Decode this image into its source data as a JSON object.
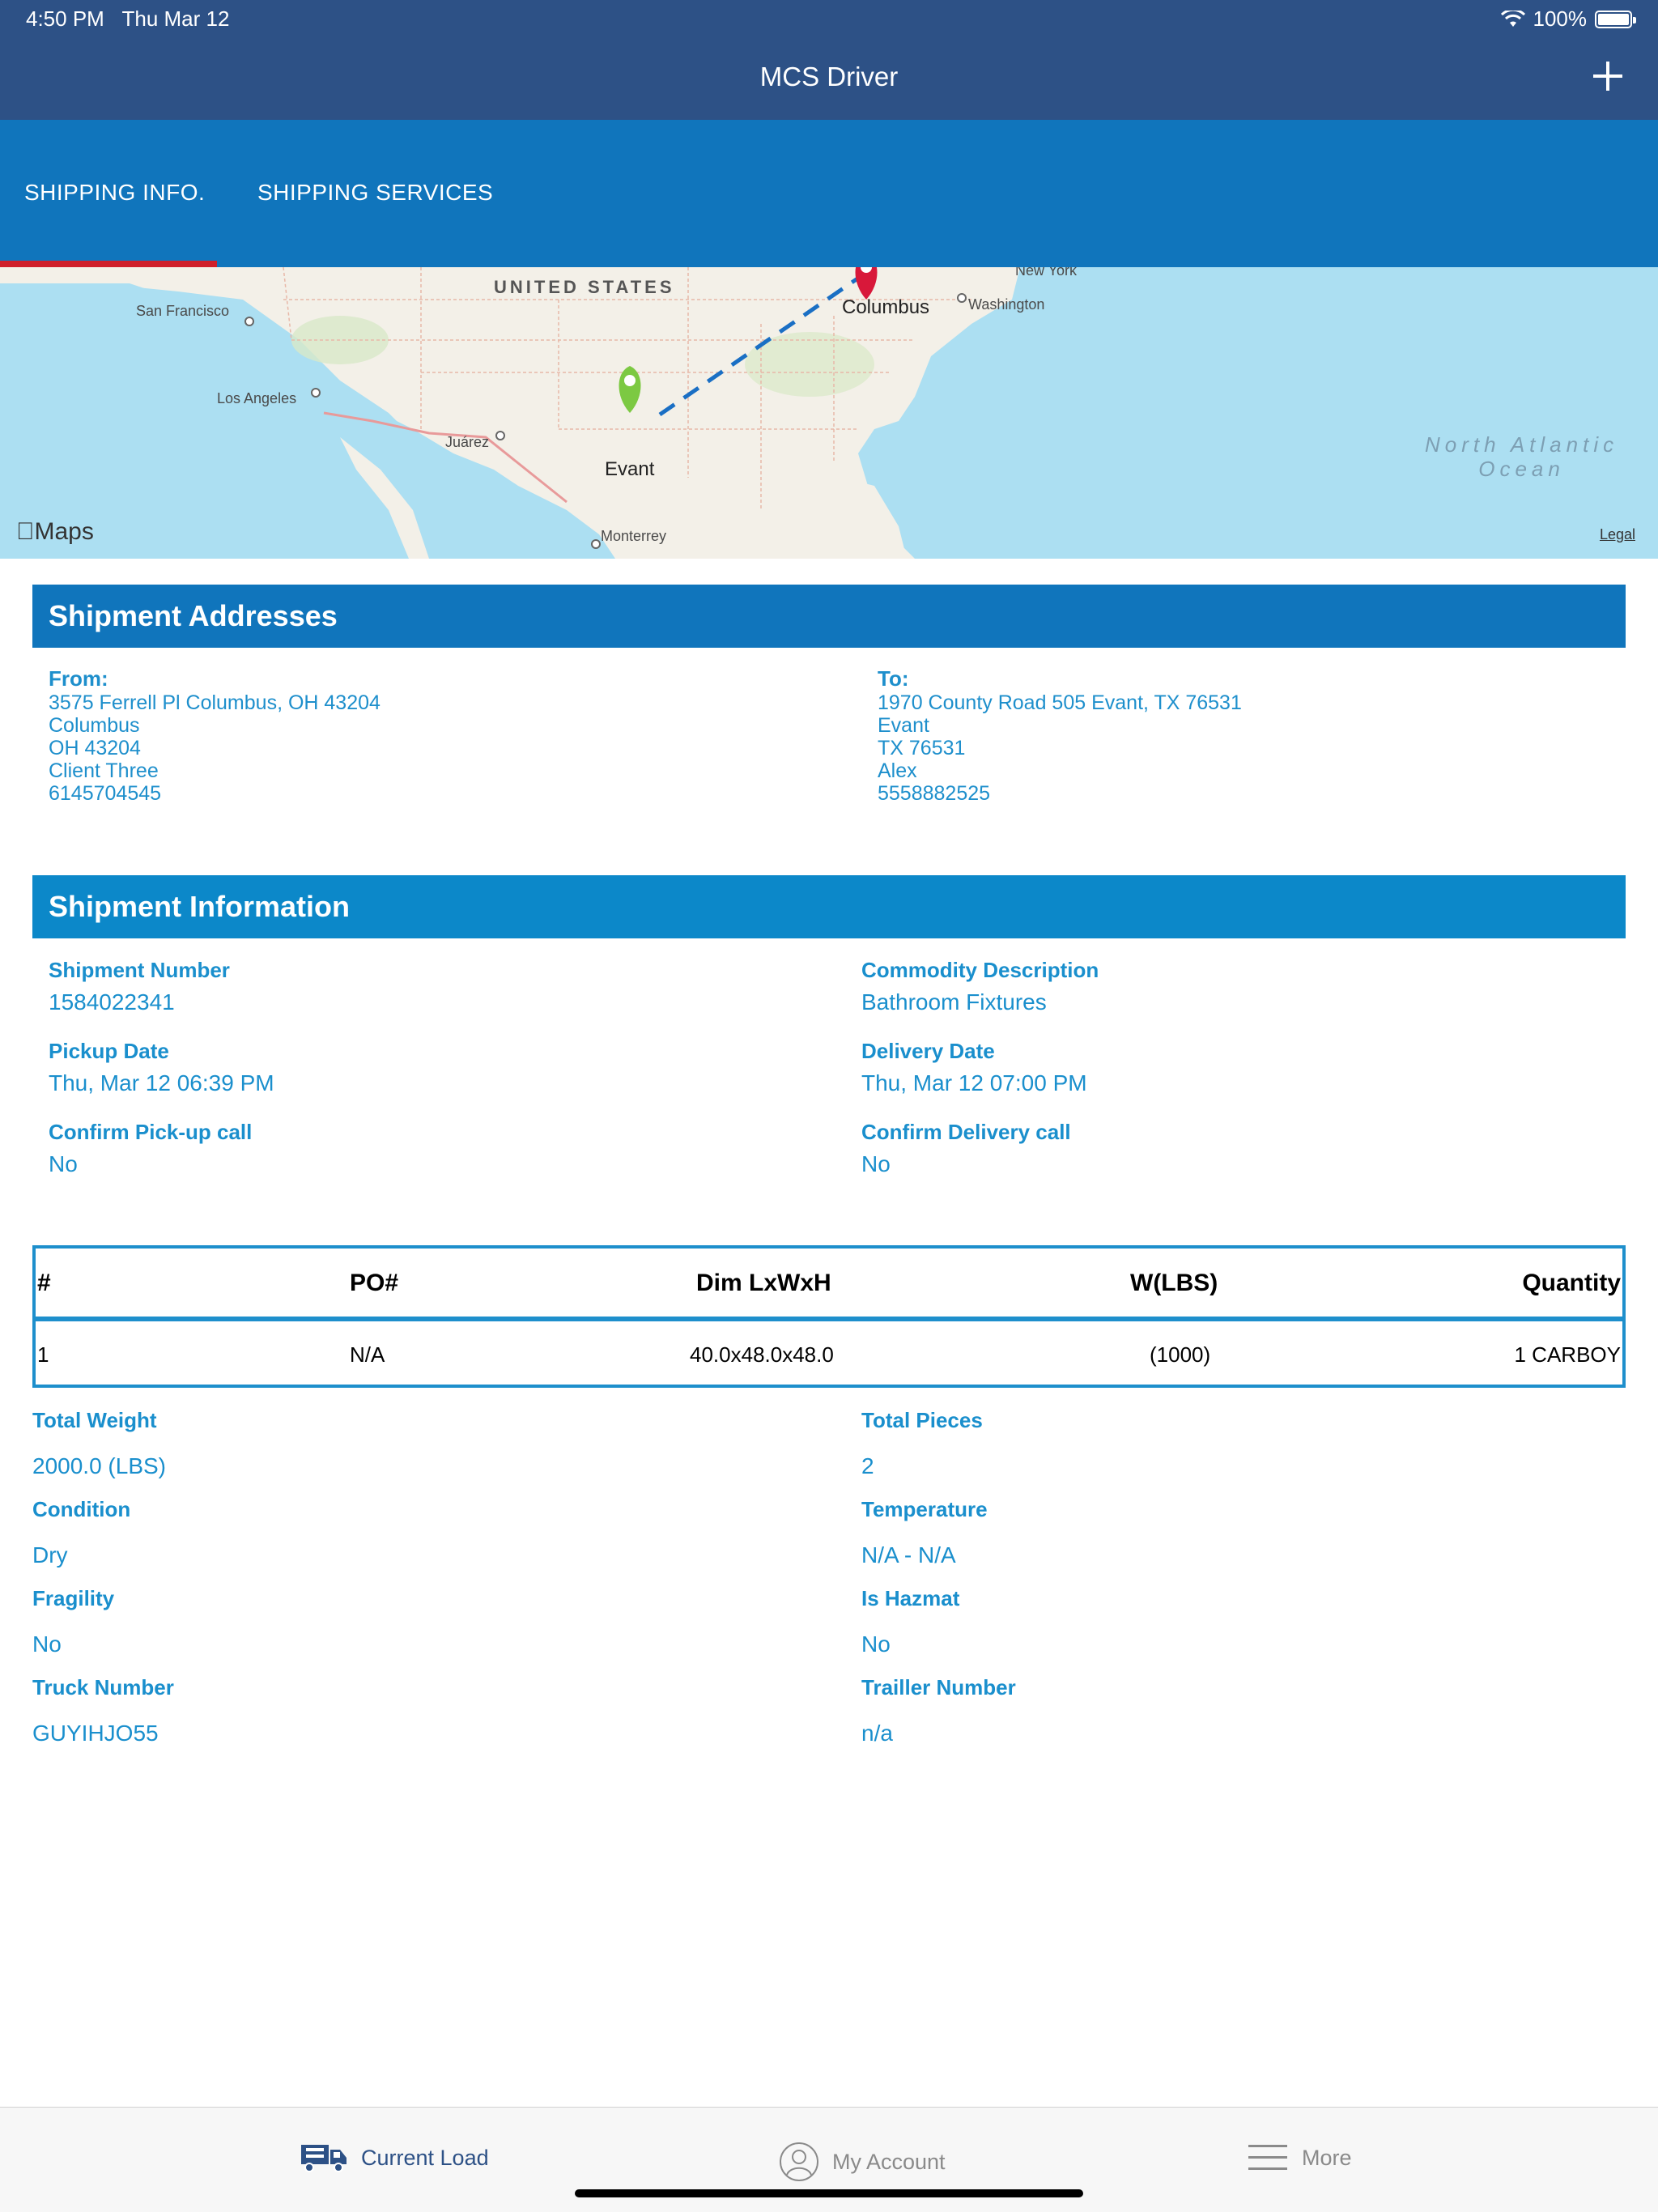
{
  "status_bar": {
    "time": "4:50 PM",
    "date": "Thu Mar 12",
    "battery": "100%"
  },
  "nav": {
    "title": "MCS Driver",
    "add_icon": "plus-icon"
  },
  "tabs": [
    {
      "label": "SHIPPING INFO.",
      "selected": true
    },
    {
      "label": "SHIPPING SERVICES",
      "selected": false
    }
  ],
  "map": {
    "country_label": "UNITED STATES",
    "ocean_label_1": "North Atlantic",
    "ocean_label_2": "Ocean",
    "cities": [
      "San Francisco",
      "Los Angeles",
      "Juárez",
      "Monterrey",
      "New York",
      "Washington"
    ],
    "origin_pin": "Columbus",
    "destination_pin": "Evant",
    "provider": "Maps",
    "legal": "Legal"
  },
  "addresses": {
    "header": "Shipment Addresses",
    "from": {
      "title": "From:",
      "lines": [
        "3575 Ferrell Pl Columbus, OH  43204",
        "Columbus",
        "OH  43204",
        "Client Three",
        "6145704545"
      ]
    },
    "to": {
      "title": "To:",
      "lines": [
        "1970 County Road 505 Evant, TX  76531",
        "Evant",
        "TX  76531",
        "Alex",
        "5558882525"
      ]
    }
  },
  "information": {
    "header": "Shipment Information",
    "shipment_number_label": "Shipment Number",
    "shipment_number": "1584022341",
    "commodity_label": "Commodity Description",
    "commodity": "Bathroom Fixtures",
    "pickup_date_label": "Pickup Date",
    "pickup_date": "Thu, Mar 12 06:39 PM",
    "delivery_date_label": "Delivery Date",
    "delivery_date": "Thu, Mar 12 07:00 PM",
    "confirm_pickup_label": "Confirm Pick-up call",
    "confirm_pickup": "No",
    "confirm_delivery_label": "Confirm Delivery call",
    "confirm_delivery": "No"
  },
  "table": {
    "headers": [
      "#",
      "PO#",
      "Dim LxWxH",
      "W(LBS)",
      "Quantity"
    ],
    "rows": [
      [
        "1",
        "N/A",
        "40.0x48.0x48.0",
        "(1000)",
        "1 CARBOY"
      ]
    ]
  },
  "summary": {
    "total_weight_label": "Total Weight",
    "total_weight": "2000.0 (LBS)",
    "total_pieces_label": "Total Pieces",
    "total_pieces": "2",
    "condition_label": "Condition",
    "condition": "Dry",
    "temperature_label": "Temperature",
    "temperature": "N/A - N/A",
    "fragility_label": "Fragility",
    "fragility": "No",
    "hazmat_label": "Is Hazmat",
    "hazmat": "No",
    "truck_label": "Truck Number",
    "truck": "GUYIHJO55",
    "trailer_label": "Trailler Number",
    "trailer": "n/a"
  },
  "bottom_tabs": [
    {
      "label": "Current Load",
      "icon": "truck-icon",
      "selected": true
    },
    {
      "label": "My Account",
      "icon": "user-icon",
      "selected": false
    },
    {
      "label": "More",
      "icon": "menu-icon",
      "selected": false
    }
  ],
  "colors": {
    "nav_bg": "#2d5186",
    "tab_bg": "#1075bc",
    "accent_text": "#1a8fcd",
    "tab_indicator": "#cf1f2a"
  }
}
